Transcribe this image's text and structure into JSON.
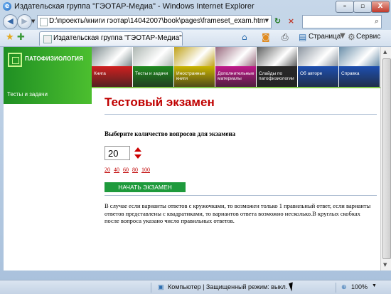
{
  "window": {
    "title": "Издательская группа \"ГЭОТАР-Медиа\" - Windows Internet Explorer",
    "buttons": [
      "–",
      "▫",
      "X"
    ]
  },
  "address_bar": {
    "url": "D:\\проекты\\книги гэотар\\14042007\\book\\pages\\frameset_exam.htm",
    "back_icon": "back-arrow-icon",
    "forward_icon": "forward-arrow-icon",
    "refresh_symbol": "↻",
    "stop_symbol": "×",
    "search_symbol": "⌕"
  },
  "toolbar": {
    "tab_title": "Издательская группа \"ГЭОТАР-Медиа\"",
    "page_label": "Страница",
    "service_label": "Сервис"
  },
  "site": {
    "brand": "ПАТОФИЗИОЛОГИЯ",
    "side_link": "Тесты и задачи",
    "menu": [
      {
        "label": "Книга",
        "color": "#d02020"
      },
      {
        "label": "Тесты и задачи",
        "color": "#1f8a1f"
      },
      {
        "label": "Иностранные книги",
        "color": "#c9b400"
      },
      {
        "label": "Дополнительные материалы",
        "color": "#c0188a"
      },
      {
        "label": "Слайды по патофизиологии",
        "color": "#282828"
      },
      {
        "label": "Об авторе",
        "color": "#1d4fb0"
      },
      {
        "label": "Справка",
        "color": "#1d4fb0"
      }
    ],
    "banner_colors": [
      "#7d8c8e",
      "#aeb7b2",
      "#c0a21a",
      "#9a6b7f",
      "#5f6060",
      "#8b95a0",
      "#6b8faa"
    ]
  },
  "exam": {
    "title": "Тестовый экзамен",
    "question_label": "Выберите количество вопросов для экзамена",
    "count_value": "20",
    "count_options": [
      "20",
      "40",
      "60",
      "80",
      "100"
    ],
    "start_button": "НАЧАТЬ ЭКЗАМЕН",
    "description": "В случае если варианты ответов с кружочками, то возможен только 1 правильный ответ, если варианты ответов представлены с квадратиками, то вариантов ответа возможно несколько.В круглых скобках после вопроса указано число правильных ответов."
  },
  "status_bar": {
    "zone": "Компьютер | Защищенный режим: выкл.",
    "zoom": "100%"
  }
}
